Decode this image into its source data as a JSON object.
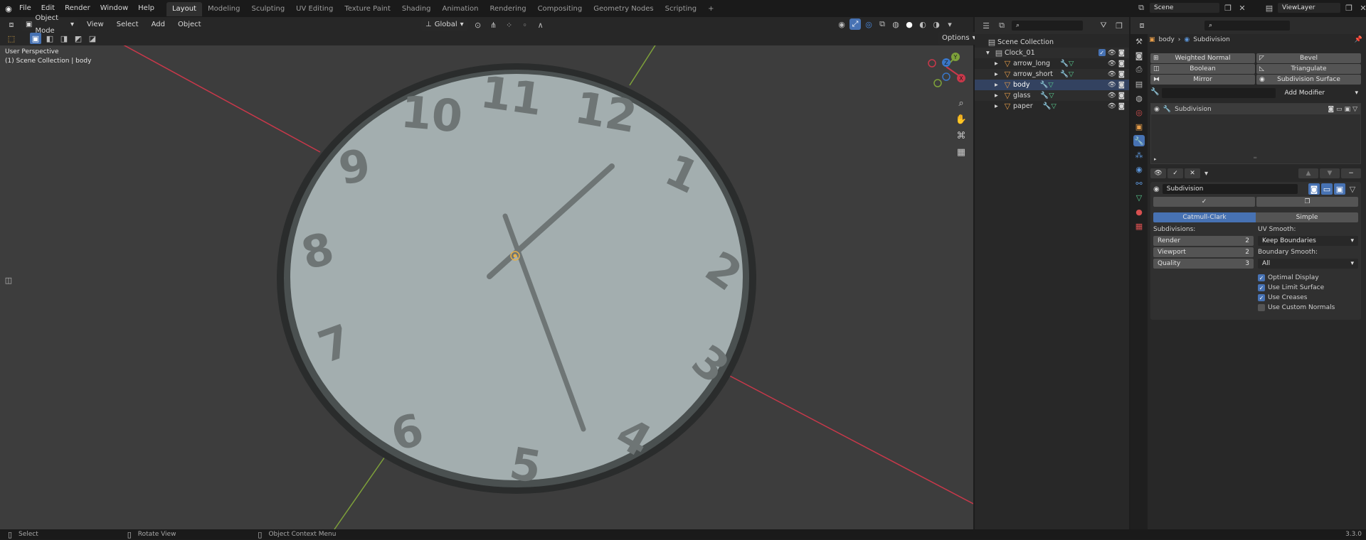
{
  "topbar": {
    "menus": [
      "File",
      "Edit",
      "Render",
      "Window",
      "Help"
    ],
    "workspaces": [
      "Layout",
      "Modeling",
      "Sculpting",
      "UV Editing",
      "Texture Paint",
      "Shading",
      "Animation",
      "Rendering",
      "Compositing",
      "Geometry Nodes",
      "Scripting"
    ],
    "active_workspace": "Layout",
    "add_tab": "+",
    "scene": "Scene",
    "view_layer": "ViewLayer"
  },
  "viewport_header": {
    "mode": "Object Mode",
    "menus": [
      "View",
      "Select",
      "Add",
      "Object"
    ],
    "orientation": "Global",
    "options": "Options"
  },
  "viewport": {
    "perspective": "User Perspective",
    "collection_info": "(1) Scene Collection | body",
    "clock_numbers": [
      "12",
      "1",
      "2",
      "3",
      "4",
      "5",
      "6",
      "7",
      "8",
      "9",
      "10",
      "11"
    ],
    "axis_x": "X",
    "axis_y": "Y",
    "axis_z": "Z"
  },
  "outliner": {
    "root": "Scene Collection",
    "collection": "Clock_01",
    "objects": [
      "arrow_long",
      "arrow_short",
      "body",
      "glass",
      "paper"
    ]
  },
  "properties": {
    "breadcrumb_object": "body",
    "breadcrumb_modifier": "Subdivision",
    "quick_modifiers": [
      "Weighted Normal",
      "Bevel",
      "Boolean",
      "Triangulate",
      "Mirror",
      "Subdivision Surface"
    ],
    "add_modifier": "Add Modifier",
    "stack_item": "Subdivision",
    "modifier_name": "Subdivision",
    "algorithm_options": [
      "Catmull-Clark",
      "Simple"
    ],
    "algorithm_selected": "Catmull-Clark",
    "subdivisions_label": "Subdivisions:",
    "render_label": "Render",
    "render_value": "2",
    "viewport_label": "Viewport",
    "viewport_value": "2",
    "quality_label": "Quality",
    "quality_value": "3",
    "uv_smooth_label": "UV Smooth:",
    "uv_smooth_value": "Keep Boundaries",
    "boundary_smooth_label": "Boundary Smooth:",
    "boundary_smooth_value": "All",
    "checkboxes": [
      {
        "label": "Optimal Display",
        "checked": true
      },
      {
        "label": "Use Limit Surface",
        "checked": true
      },
      {
        "label": "Use Creases",
        "checked": true
      },
      {
        "label": "Use Custom Normals",
        "checked": false
      }
    ]
  },
  "statusbar": {
    "select": "Select",
    "rotate": "Rotate View",
    "context": "Object Context Menu",
    "version": "3.3.0"
  },
  "colors": {
    "accent": "#4772b3",
    "axis_x": "#c9384a",
    "axis_y": "#7ea13a",
    "axis_z": "#3a77c9",
    "object_orange": "#e59c49",
    "mesh_green": "#58c98f"
  }
}
